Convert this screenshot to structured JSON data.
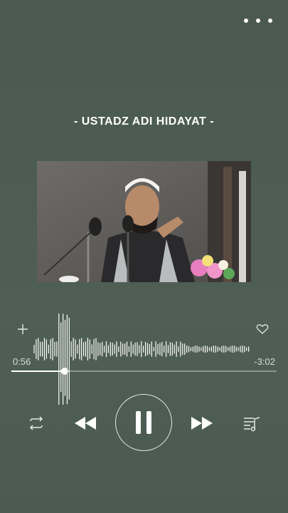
{
  "header": {
    "more_icon": "more-dots-icon"
  },
  "track": {
    "title": "- USTADZ ADI HIDAYAT -",
    "elapsed": "0:56",
    "remaining": "-3:02",
    "progress": 0.2
  },
  "controls": {
    "add_icon": "plus-icon",
    "like_icon": "heart-icon",
    "repeat_icon": "repeat-icon",
    "rewind_icon": "rewind-icon",
    "pause_icon": "pause-icon",
    "forward_icon": "fast-forward-icon",
    "queue_icon": "music-queue-icon"
  },
  "colors": {
    "background": "#4c5c52",
    "accent": "#ffffff"
  }
}
